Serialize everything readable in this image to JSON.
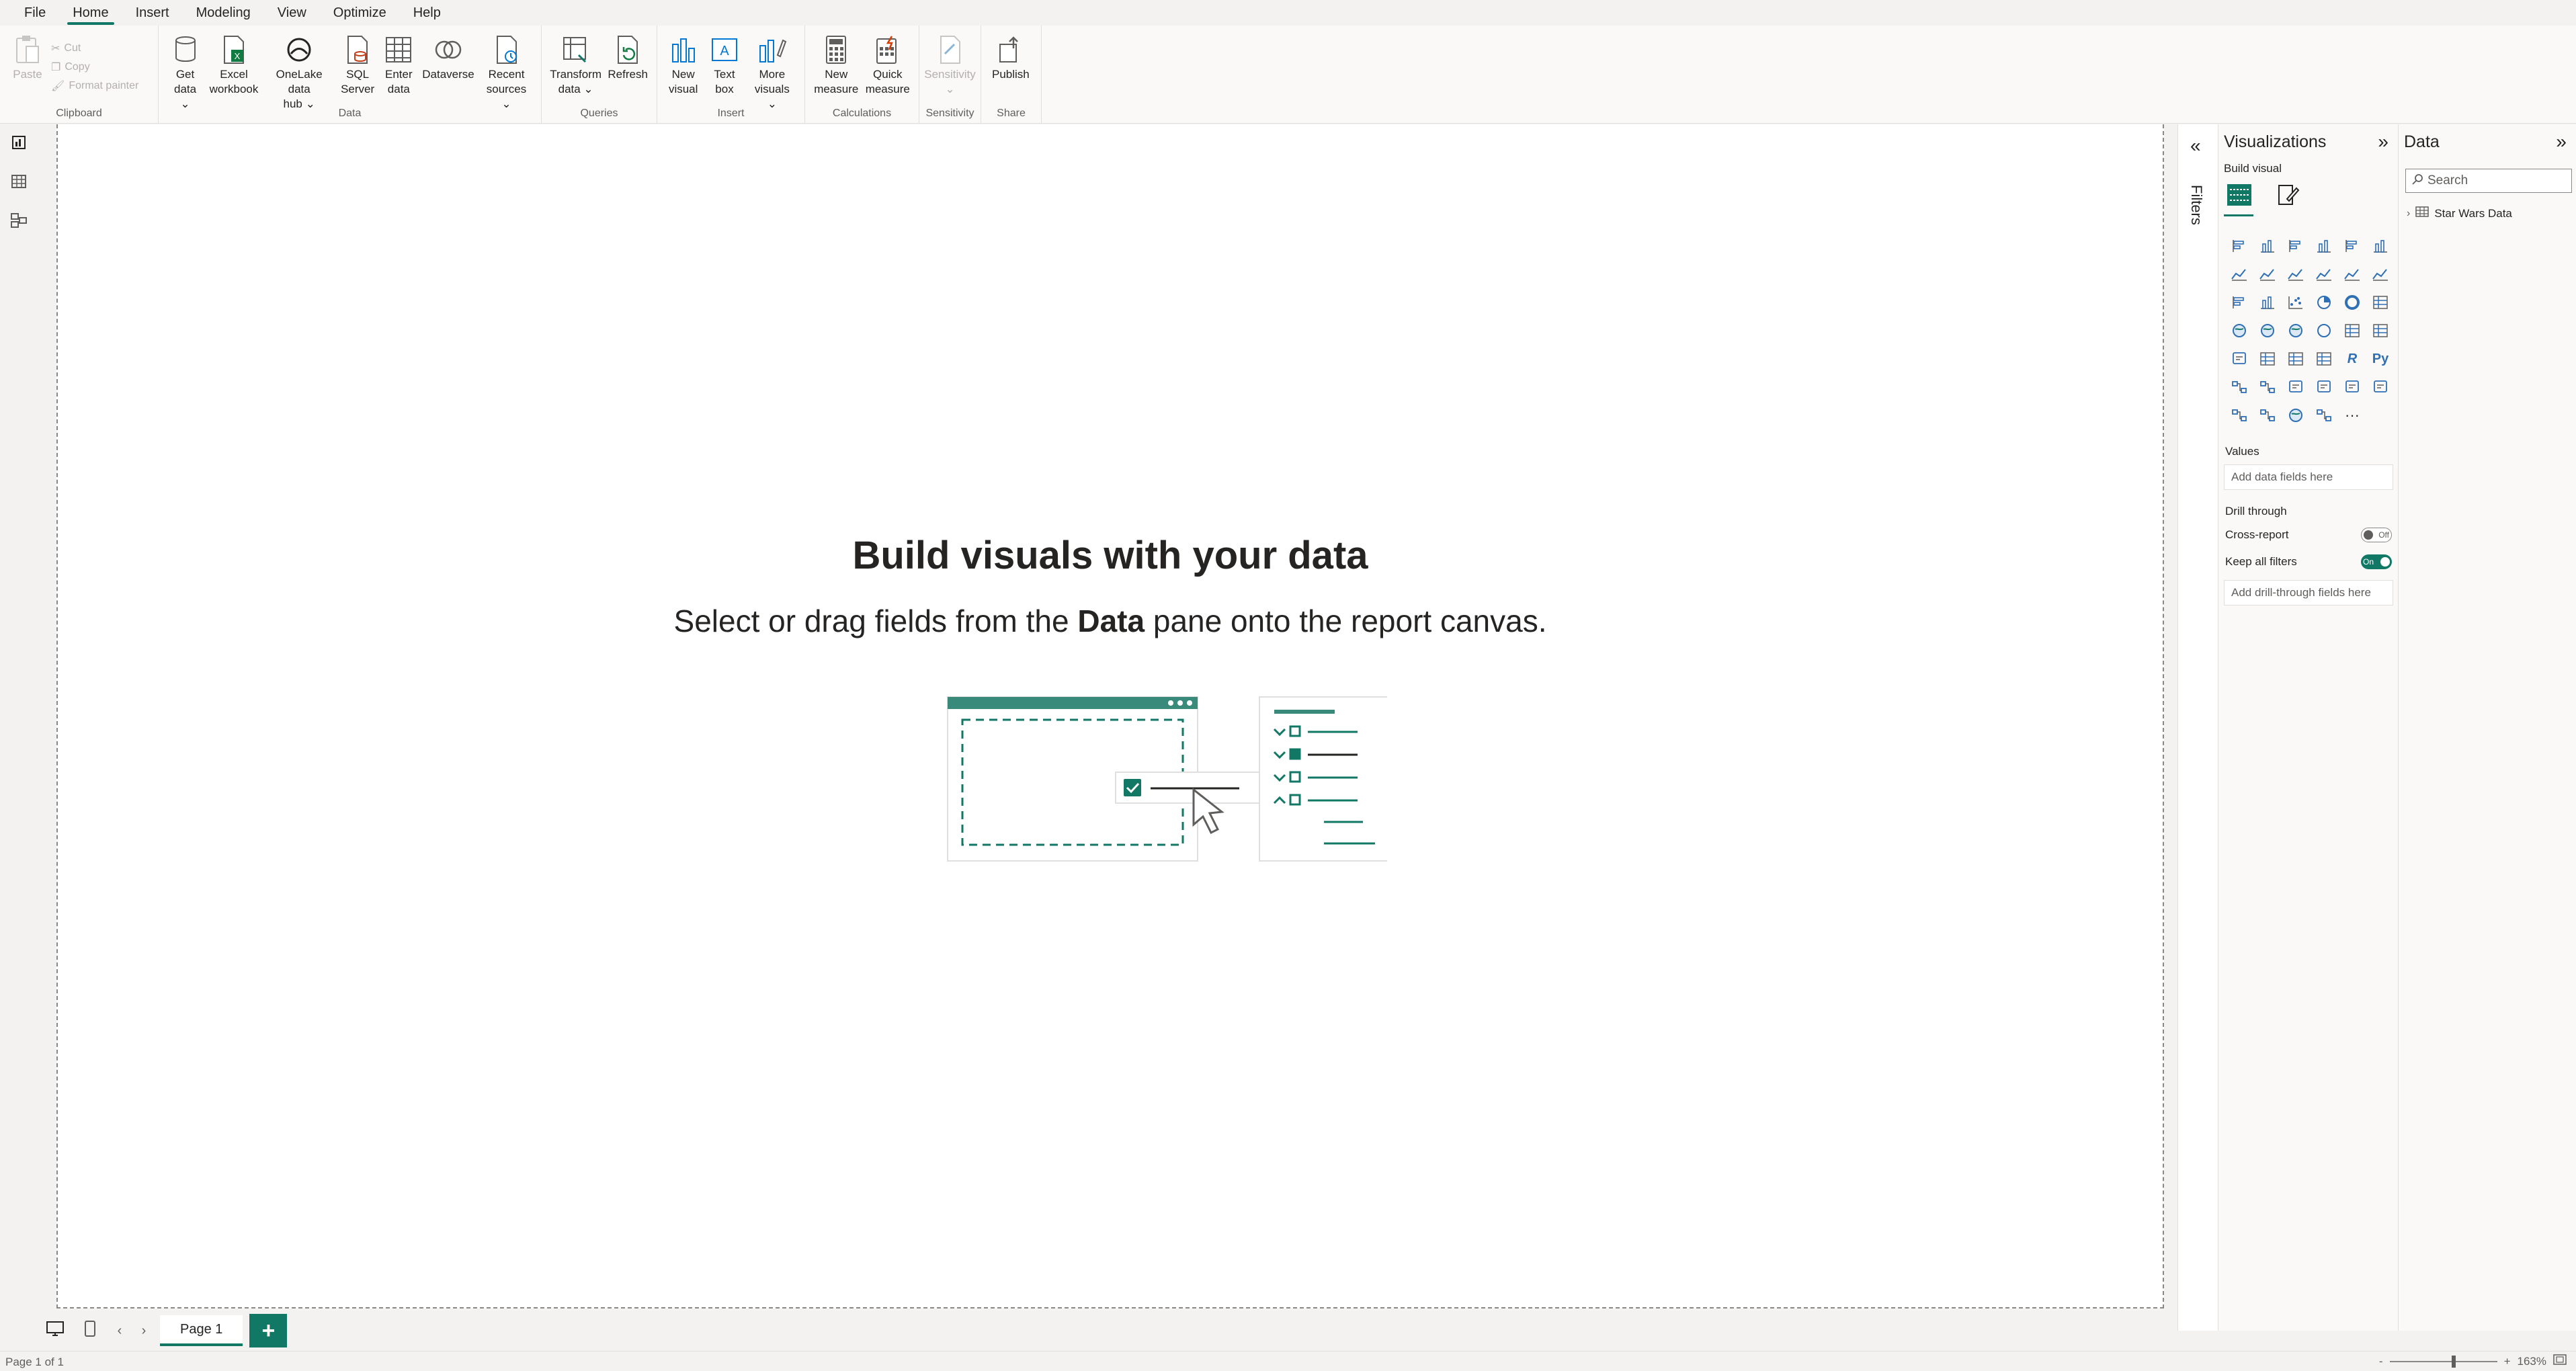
{
  "menu": [
    "File",
    "Home",
    "Insert",
    "Modeling",
    "View",
    "Optimize",
    "Help"
  ],
  "menu_active": "Home",
  "ribbon": {
    "clipboard": {
      "paste": "Paste",
      "cut": "Cut",
      "copy": "Copy",
      "format_painter": "Format painter",
      "label": "Clipboard"
    },
    "data": {
      "label": "Data",
      "get_data": "Get\ndata ⌄",
      "excel": "Excel\nworkbook",
      "onelake": "OneLake data\nhub ⌄",
      "sql": "SQL\nServer",
      "enter": "Enter\ndata",
      "dataverse": "Dataverse",
      "recent": "Recent\nsources ⌄"
    },
    "queries": {
      "label": "Queries",
      "transform": "Transform\ndata ⌄",
      "refresh": "Refresh"
    },
    "insert": {
      "label": "Insert",
      "new_visual": "New\nvisual",
      "text_box": "Text\nbox",
      "more_visuals": "More\nvisuals ⌄"
    },
    "calculations": {
      "label": "Calculations",
      "new_measure": "New\nmeasure",
      "quick_measure": "Quick\nmeasure"
    },
    "sensitivity": {
      "label": "Sensitivity",
      "sensitivity": "Sensitivity\n⌄"
    },
    "share": {
      "label": "Share",
      "publish": "Publish"
    }
  },
  "canvas": {
    "title": "Build visuals with your data",
    "sub_before": "Select or drag fields from the ",
    "sub_bold": "Data",
    "sub_after": " pane onto the report canvas."
  },
  "filters": {
    "label": "Filters"
  },
  "visualizations": {
    "title": "Visualizations",
    "build_visual": "Build visual",
    "values_label": "Values",
    "values_placeholder": "Add data fields here",
    "drill_through": "Drill through",
    "cross_report": "Cross-report",
    "cross_report_state": "Off",
    "keep_all_filters": "Keep all filters",
    "keep_all_filters_state": "On",
    "drill_placeholder": "Add drill-through fields here"
  },
  "data_pane": {
    "title": "Data",
    "search_placeholder": "Search",
    "tables": [
      "Star Wars Data"
    ]
  },
  "pages": {
    "tab": "Page 1",
    "add": "+"
  },
  "status": {
    "page_info": "Page 1 of 1",
    "zoom": "163%",
    "zoom_level": 0.6
  }
}
